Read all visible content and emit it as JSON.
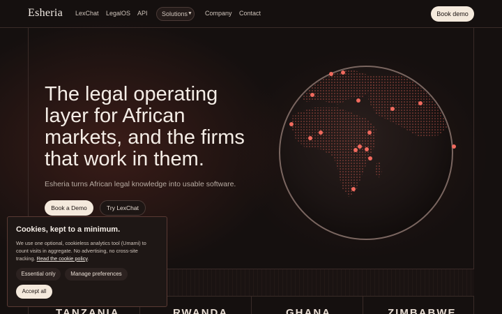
{
  "nav": {
    "brand": "Esheria",
    "links": [
      "LexChat",
      "LegalOS",
      "API"
    ],
    "solutions_label": "Solutions",
    "links_right": [
      "Company",
      "Contact"
    ],
    "book_demo": "Book demo"
  },
  "hero": {
    "title": "The legal operating layer for African markets, and the firms that work in them.",
    "subtitle": "Esheria turns African legal knowledge into usable software.",
    "primary_cta": "Book a Demo",
    "secondary_cta": "Try LexChat"
  },
  "countries": [
    "TANZANIA",
    "RWANDA",
    "GHANA",
    "ZIMBABWE"
  ],
  "cookie": {
    "title": "Cookies, kept to a minimum.",
    "body": "We use one optional, cookieless analytics tool (Umami) to count visits in aggregate. No advertising, no cross-site tracking.",
    "link": "Read the cookie policy",
    "essential": "Essential only",
    "manage": "Manage preferences",
    "accept": "Accept all"
  },
  "colors": {
    "background": "#15100f",
    "accent_light": "#f4e9dc",
    "marker": "#f06a5e"
  },
  "icons": [
    "chevron-down-icon"
  ]
}
